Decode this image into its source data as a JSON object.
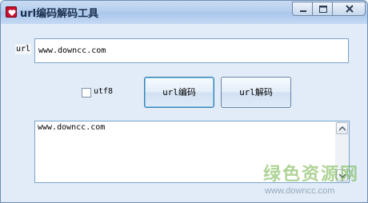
{
  "window": {
    "title": "url编码解码工具",
    "controls": [
      "minimize",
      "maximize",
      "close"
    ]
  },
  "form": {
    "url_label": "url",
    "url_value": "www.downcc.com",
    "checkbox_label": "utf8",
    "checkbox_checked": false,
    "encode_label": "url编码",
    "decode_label": "url解码"
  },
  "output": {
    "text": "www.downcc.com"
  },
  "watermark": {
    "logo": "绿色资源网",
    "url": "www.downcc.com"
  },
  "colors": {
    "accent": "#c8102e",
    "window_bg": "#e1ecf8",
    "watermark_green": "#6eb042"
  },
  "icons": [
    "app-heart-icon",
    "minimize-icon",
    "maximize-icon",
    "close-icon",
    "scroll-up-icon",
    "scroll-down-icon"
  ]
}
